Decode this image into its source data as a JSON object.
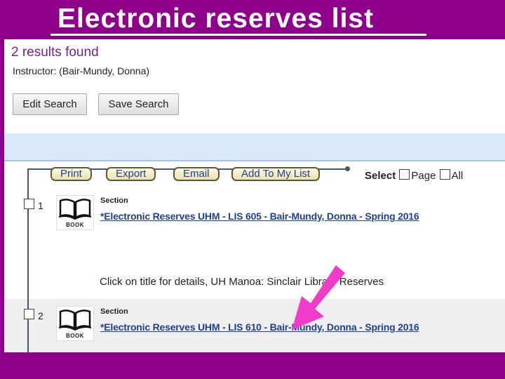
{
  "slide_title": "Electronic reserves list",
  "results_count": "2 results found",
  "instructor": "Instructor: (Bair-Mundy, Donna)",
  "buttons": {
    "edit_search": "Edit Search",
    "save_search": "Save Search"
  },
  "actions": {
    "print": "Print",
    "export": "Export",
    "email": "Email",
    "add_to_list": "Add To My List"
  },
  "select": {
    "label": "Select",
    "page": "Page",
    "all": "All"
  },
  "records": [
    {
      "number": "1",
      "format": "BOOK",
      "section_label": "Section",
      "title": "*Electronic Reserves UHM - LIS 605 - Bair-Mundy, Donna - Spring 2016"
    },
    {
      "number": "2",
      "format": "BOOK",
      "section_label": "Section",
      "title": "*Electronic Reserves UHM - LIS 610 - Bair-Mundy, Donna - Spring 2016"
    }
  ],
  "record_note": "Click on title for details, UH Manoa: Sinclair Library Reserves",
  "colors": {
    "slide_bg": "#8e0089",
    "link": "#1f3f93",
    "results": "#7a1f8e",
    "arrow": "#f03cc8"
  }
}
